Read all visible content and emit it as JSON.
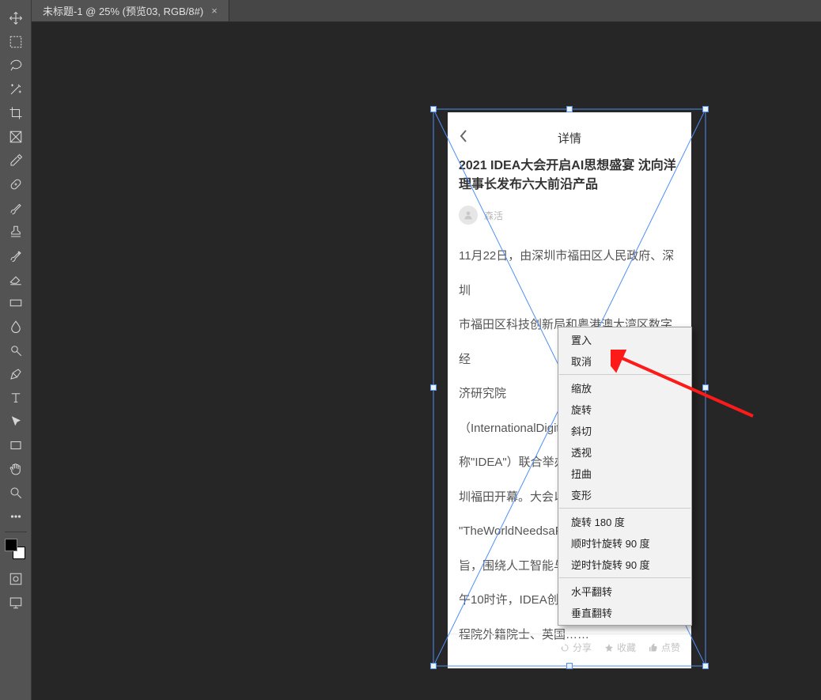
{
  "tab": {
    "title": "未标题-1 @ 25% (预览03, RGB/8#)"
  },
  "tools": [
    "move",
    "marquee",
    "lasso",
    "wand",
    "crop",
    "frame",
    "eyedropper",
    "healing",
    "brush",
    "stamp",
    "history-brush",
    "eraser",
    "gradient",
    "blur",
    "dodge",
    "pen",
    "type",
    "arrow",
    "rectangle",
    "hand",
    "zoom"
  ],
  "doc": {
    "header_title": "详情",
    "headline": "2021 IDEA大会开启AI思想盛宴 沈向洋理事长发布六大前沿产品",
    "author": "森活",
    "body_lines": [
      "11月22日，由深圳市福田区人民政府、深圳",
      "市福田区科技创新局和粤港澳大湾区数字经",
      "济研究院",
      "（InternationalDigital……",
      "称\"IDEA\"）联合举办……",
      "圳福田开幕。大会以……",
      "\"TheWorldNeedsaFe……",
      "旨，围绕人工智能与……",
      "午10时许，IDEA创院……",
      "程院外籍院士、英国……"
    ],
    "footer": {
      "share": "分享",
      "fav": "收藏",
      "like": "点赞"
    }
  },
  "menu": {
    "place": "置入",
    "cancel": "取消",
    "scale": "缩放",
    "rotate": "旋转",
    "skew": "斜切",
    "perspective": "透视",
    "distort": "扭曲",
    "warp": "变形",
    "rotate180": "旋转 180 度",
    "rotateCW": "顺时针旋转 90 度",
    "rotateCCW": "逆时针旋转 90 度",
    "flipH": "水平翻转",
    "flipV": "垂直翻转"
  }
}
